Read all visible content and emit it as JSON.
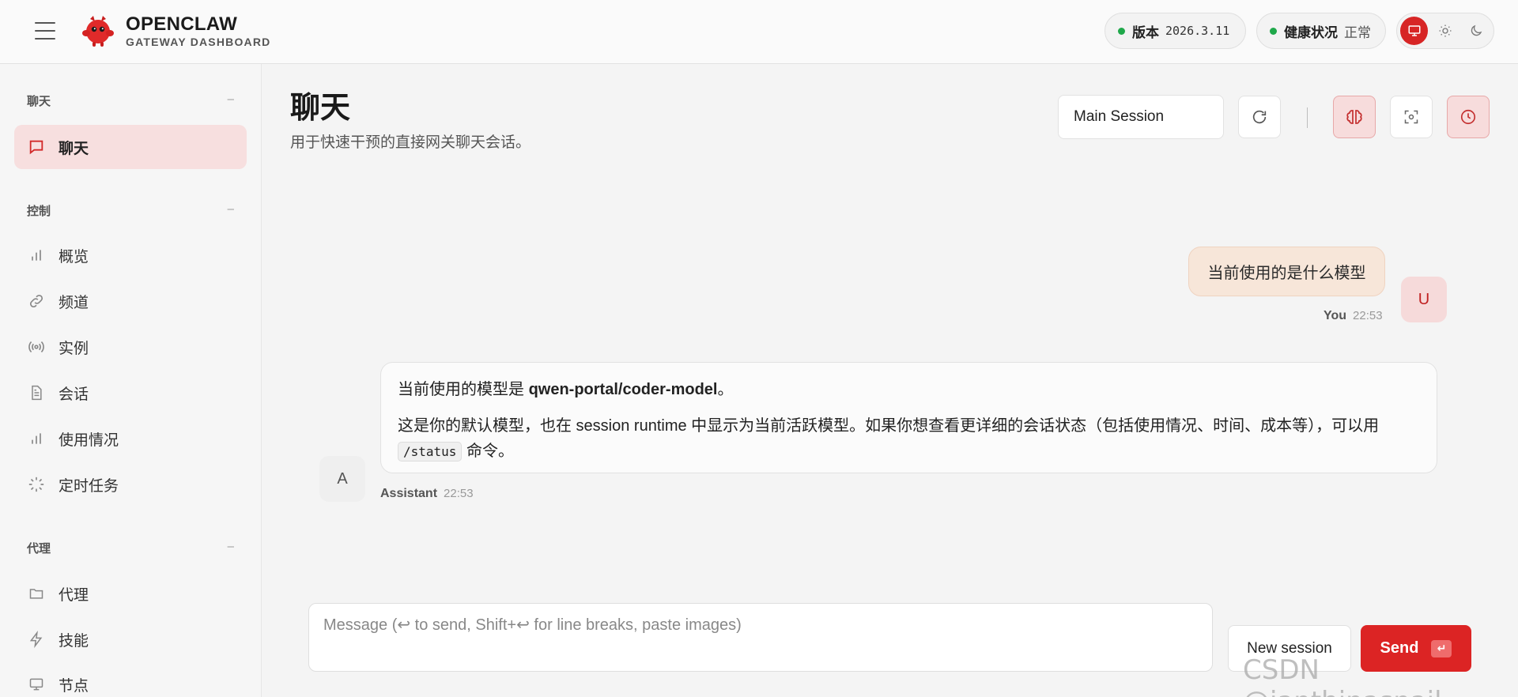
{
  "brand": {
    "title": "OPENCLAW",
    "subtitle": "GATEWAY DASHBOARD"
  },
  "status": {
    "version_label": "版本",
    "version_value": "2026.3.11",
    "health_label": "健康状况",
    "health_value": "正常",
    "ok_color": "#1fa84a"
  },
  "theme": {
    "options": [
      "monitor-icon",
      "sun-icon",
      "moon-icon"
    ],
    "active": "monitor-icon"
  },
  "sidebar": {
    "sections": [
      {
        "label": "聊天",
        "collapse": "–"
      },
      {
        "label": "控制",
        "collapse": "–"
      },
      {
        "label": "代理",
        "collapse": "–"
      }
    ],
    "items": [
      {
        "label": "聊天",
        "icon": "message-icon",
        "active": true
      },
      {
        "label": "概览",
        "icon": "bar-chart-icon"
      },
      {
        "label": "频道",
        "icon": "link-icon"
      },
      {
        "label": "实例",
        "icon": "broadcast-icon"
      },
      {
        "label": "会话",
        "icon": "document-icon"
      },
      {
        "label": "使用情况",
        "icon": "bar-chart-icon"
      },
      {
        "label": "定时任务",
        "icon": "loader-icon"
      },
      {
        "label": "代理",
        "icon": "folder-icon"
      },
      {
        "label": "技能",
        "icon": "lightning-icon"
      },
      {
        "label": "节点",
        "icon": "monitor-icon"
      }
    ]
  },
  "page": {
    "title": "聊天",
    "subtitle": "用于快速干预的直接网关聊天会话。"
  },
  "toolbar": {
    "session": "Main Session"
  },
  "messages": {
    "user": {
      "text": "当前使用的是什么模型",
      "avatar": "U",
      "author": "You",
      "time": "22:53"
    },
    "assistant": {
      "avatar": "A",
      "author": "Assistant",
      "time": "22:53",
      "p1_prefix": "当前使用的模型是 ",
      "p1_bold": "qwen-portal/coder-model",
      "p1_suffix": "。",
      "p2_prefix": "这是你的默认模型，也在 session runtime 中显示为当前活跃模型。如果你想查看更详细的会话状态（包括使用情况、时间、成本等），可以用 ",
      "p2_code": "/status",
      "p2_suffix": " 命令。"
    }
  },
  "composer": {
    "placeholder": "Message (↩ to send, Shift+↩ for line breaks, paste images)",
    "new_session": "New session",
    "send": "Send",
    "send_kbd": "↵"
  },
  "watermark": "CSDN @janthinasnail",
  "colors": {
    "accent": "#dc2424",
    "active_nav_bg": "#f7dfdf",
    "user_bubble": "#f7e6d9"
  }
}
